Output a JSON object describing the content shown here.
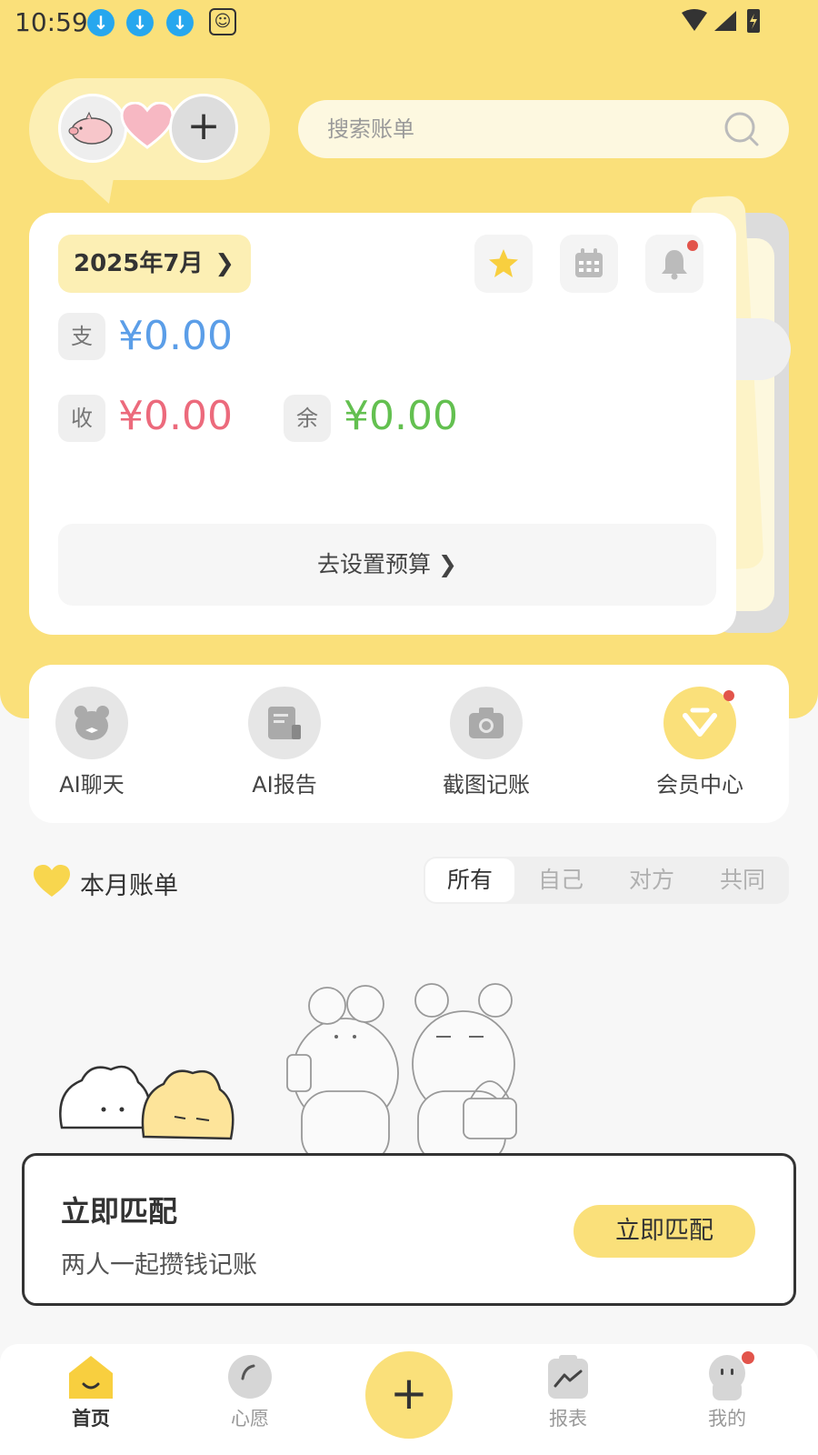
{
  "status_bar": {
    "time": "10:59"
  },
  "search": {
    "placeholder": "搜索账单"
  },
  "summary_card": {
    "month": "2025年7月",
    "expense": {
      "label": "支",
      "amount": "¥0.00",
      "color": "#5b9ee8"
    },
    "income": {
      "label": "收",
      "amount": "¥0.00",
      "color": "#ec6a7c"
    },
    "balance": {
      "label": "余",
      "amount": "¥0.00",
      "color": "#63c050"
    },
    "budget_button": "去设置预算"
  },
  "features": [
    {
      "label": "AI聊天",
      "icon": "bear-chat-icon"
    },
    {
      "label": "AI报告",
      "icon": "report-icon"
    },
    {
      "label": "截图记账",
      "icon": "camera-icon"
    },
    {
      "label": "会员中心",
      "icon": "diamond-icon"
    }
  ],
  "bill_section": {
    "title": "本月账单",
    "tabs": [
      "所有",
      "自己",
      "对方",
      "共同"
    ],
    "active_tab": "所有"
  },
  "match_card": {
    "title": "立即匹配",
    "subtitle": "两人一起攒钱记账",
    "button": "立即匹配"
  },
  "bottom_nav": {
    "items": [
      {
        "label": "首页",
        "icon": "home-icon",
        "active": true
      },
      {
        "label": "心愿",
        "icon": "wish-icon"
      },
      {
        "label": "报表",
        "icon": "chart-icon"
      },
      {
        "label": "我的",
        "icon": "profile-icon"
      }
    ],
    "fab": "+"
  },
  "colors": {
    "accent": "#fae07a",
    "accent_light": "#fcefb4",
    "notification_dot": "#e2544b"
  }
}
